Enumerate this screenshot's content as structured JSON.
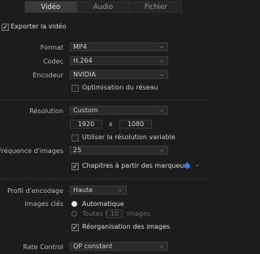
{
  "tabs": [
    "Vidéo",
    "Audio",
    "Fichier"
  ],
  "export_video": "Exporter la vidéo",
  "format": {
    "label": "Format",
    "value": "MP4"
  },
  "codec": {
    "label": "Codec",
    "value": "H.264"
  },
  "encoder": {
    "label": "Encodeur",
    "value": "NVIDIA"
  },
  "network_opt": "Optimisation du réseau",
  "resolution": {
    "label": "Résolution",
    "value": "Custom",
    "width": "1920",
    "x": "x",
    "height": "1080"
  },
  "variable_res": "Utiliser la résolution variable",
  "framerate": {
    "label": "Fréquence d'images",
    "value": "25"
  },
  "chapters": "Chapitres à partir des marqueurs",
  "profile": {
    "label": "Profil d'encodage",
    "value": "Haute"
  },
  "keyframes": {
    "label": "Images clés",
    "auto": "Automatique",
    "every": "Toutes les",
    "every_value": "10",
    "every_unit": "images"
  },
  "reorder": "Réorganisation des images",
  "rate_control": {
    "label": "Rate Control",
    "value": "QP constant"
  },
  "colors": {
    "accent": "#2f7cf6"
  }
}
